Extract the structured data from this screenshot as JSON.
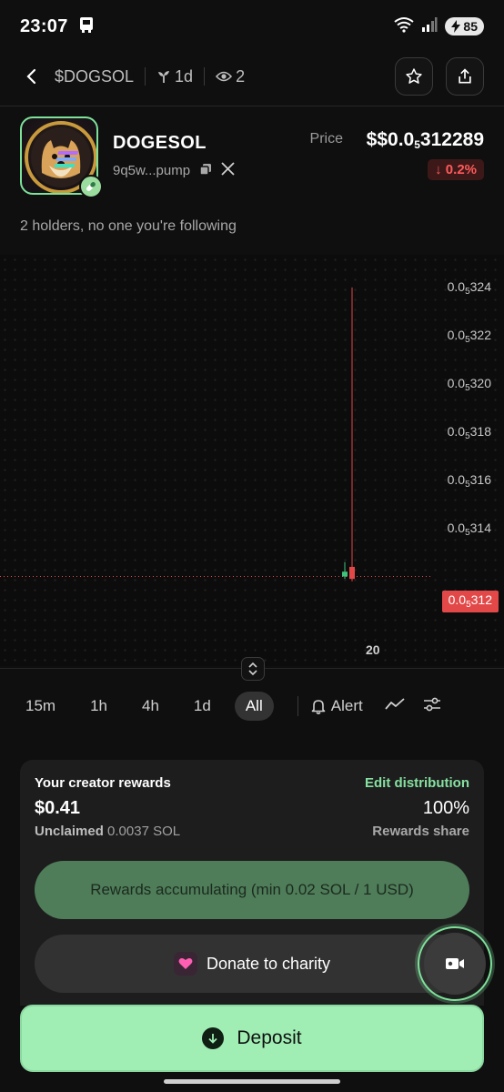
{
  "status_bar": {
    "time": "23:07",
    "battery": "85"
  },
  "nav": {
    "ticker": "$DOGSOL",
    "age": "1d",
    "viewers": "2"
  },
  "token": {
    "name": "DOGESOL",
    "address": "9q5w...pump",
    "price_label": "Price",
    "price_prefix": "$0.0",
    "price_sub": "5",
    "price_rest": "312289",
    "change": "↓ 0.2%"
  },
  "holders_text": "2 holders, no one you're following",
  "chart_data": {
    "type": "candlestick",
    "y_ticks": [
      {
        "prefix": "0.0",
        "sub": "5",
        "rest": "324"
      },
      {
        "prefix": "0.0",
        "sub": "5",
        "rest": "322"
      },
      {
        "prefix": "0.0",
        "sub": "5",
        "rest": "320"
      },
      {
        "prefix": "0.0",
        "sub": "5",
        "rest": "318"
      },
      {
        "prefix": "0.0",
        "sub": "5",
        "rest": "316"
      },
      {
        "prefix": "0.0",
        "sub": "5",
        "rest": "314"
      }
    ],
    "current_price": {
      "prefix": "0.0",
      "sub": "5",
      "rest": "312"
    },
    "x_ticks": [
      "20"
    ],
    "candles": [
      {
        "open": 3.12e-06,
        "close": 3.122e-06,
        "high": 3.126e-06,
        "low": 3.119e-06,
        "color": "green"
      },
      {
        "open": 3.124e-06,
        "close": 3.119e-06,
        "high": 3.24e-06,
        "low": 3.118e-06,
        "color": "red"
      }
    ],
    "ylim": [
      3.11e-06,
      3.246e-06
    ],
    "colors": {
      "up": "#3fc37a",
      "down": "#e34848"
    }
  },
  "timeframes": [
    "15m",
    "1h",
    "4h",
    "1d",
    "All"
  ],
  "active_timeframe": "All",
  "alert_label": "Alert",
  "rewards": {
    "title": "Your creator rewards",
    "edit_label": "Edit distribution",
    "amount": "$0.41",
    "share_pct": "100%",
    "unclaimed_label": "Unclaimed",
    "unclaimed_value": "0.0037 SOL",
    "share_label": "Rewards share",
    "accumulating_label": "Rewards accumulating (min 0.02 SOL / 1 USD)",
    "donate_label": "Donate to charity"
  },
  "deposit_label": "Deposit"
}
